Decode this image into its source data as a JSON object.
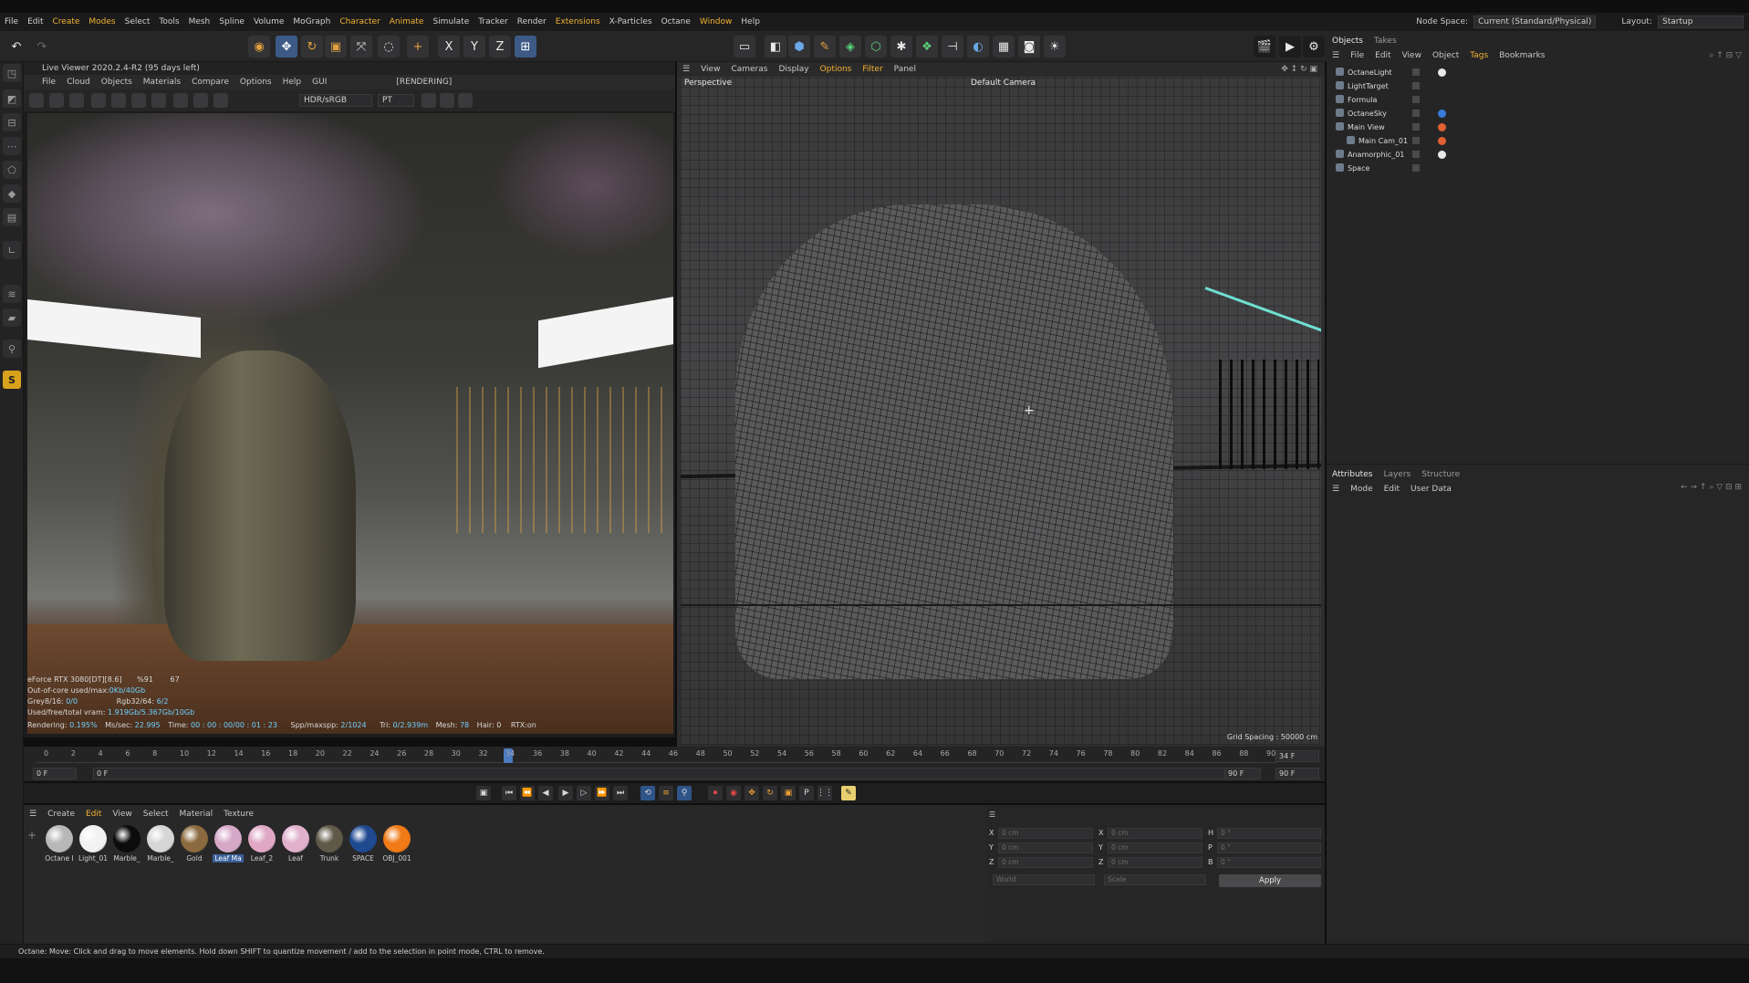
{
  "menubar": {
    "items": [
      {
        "label": "File"
      },
      {
        "label": "Edit"
      },
      {
        "label": "Create"
      },
      {
        "label": "Modes"
      },
      {
        "label": "Select"
      },
      {
        "label": "Tools"
      },
      {
        "label": "Mesh"
      },
      {
        "label": "Spline"
      },
      {
        "label": "Volume"
      },
      {
        "label": "MoGraph"
      },
      {
        "label": "Character"
      },
      {
        "label": "Animate"
      },
      {
        "label": "Simulate"
      },
      {
        "label": "Tracker"
      },
      {
        "label": "Render"
      },
      {
        "label": "Extensions"
      },
      {
        "label": "X-Particles"
      },
      {
        "label": "Octane"
      },
      {
        "label": "Window"
      },
      {
        "label": "Help"
      }
    ],
    "node_space_label": "Node Space:",
    "node_space_value": "Current (Standard/Physical)",
    "layout_label": "Layout:",
    "layout_value": "Startup"
  },
  "live_viewer": {
    "title": "Live Viewer 2020.2.4-R2 (95 days left)",
    "menu": [
      "File",
      "Cloud",
      "Objects",
      "Materials",
      "Compare",
      "Options",
      "Help",
      "GUI"
    ],
    "status": "[RENDERING]",
    "colorspace": "HDR/sRGB",
    "kernel": "PT",
    "stats": {
      "gpu": "eForce RTX 3080[DT][8.6]",
      "gpu_pct": "%91",
      "gpu_temp": "67",
      "ooc_label": "Out-of-core used/max:",
      "ooc_value": "0Kb/40Gb",
      "grey_label": "Grey8/16:",
      "grey_value": "0/0",
      "rgb_label": "Rgb32/64:",
      "rgb_value": "6/2",
      "vram_label": "Used/free/total vram:",
      "vram_value": "1.919Gb/5.367Gb/10Gb",
      "rendering_label": "Rendering:",
      "rendering_value": "0.195%",
      "mssec_label": "Ms/sec:",
      "mssec_value": "22.995",
      "time_label": "Time:",
      "time_value": "00 : 00 : 00/00 : 01 : 23",
      "spp_label": "Spp/maxspp:",
      "spp_value": "2/1024",
      "tri_label": "Tri:",
      "tri_value": "0/2.939m",
      "mesh_label": "Mesh:",
      "mesh_value": "78",
      "hair_label": "Hair:",
      "hair_value": "0",
      "rtx": "RTX:on"
    }
  },
  "viewport": {
    "menu": [
      "View",
      "Cameras",
      "Display",
      "Options",
      "Filter",
      "Panel"
    ],
    "label": "Perspective",
    "camera": "Default Camera",
    "grid_spacing": "Grid Spacing : 50000 cm"
  },
  "timeline": {
    "ticks": [
      "0",
      "2",
      "4",
      "6",
      "8",
      "10",
      "12",
      "14",
      "16",
      "18",
      "20",
      "22",
      "24",
      "26",
      "28",
      "30",
      "32",
      "34",
      "36",
      "38",
      "40",
      "42",
      "44",
      "46",
      "48",
      "50",
      "52",
      "54",
      "56",
      "58",
      "60",
      "62",
      "64",
      "66",
      "68",
      "70",
      "72",
      "74",
      "76",
      "78",
      "80",
      "82",
      "84",
      "86",
      "88",
      "90"
    ],
    "current_frame": "34 F",
    "start_a": "0 F",
    "start_b": "0 F",
    "end_a": "90 F",
    "end_b": "90 F",
    "playhead_fraction": 0.3778
  },
  "materials": {
    "menu": [
      "Create",
      "Edit",
      "View",
      "Select",
      "Material",
      "Texture"
    ],
    "items": [
      {
        "name": "Octane I",
        "color": "#b8b8b8"
      },
      {
        "name": "Light_01",
        "color": "#f2f2f2"
      },
      {
        "name": "Marble_",
        "color": "#0c0c0c"
      },
      {
        "name": "Marble_",
        "color": "#d6d6d6"
      },
      {
        "name": "Gold",
        "color": "#8a6a3e"
      },
      {
        "name": "Leaf Ma",
        "color": "#d6a8c8"
      },
      {
        "name": "Leaf_2",
        "color": "#e0a8c4"
      },
      {
        "name": "Leaf",
        "color": "#e0b0cc"
      },
      {
        "name": "Trunk",
        "color": "#5f5a48"
      },
      {
        "name": "SPACE",
        "color": "#1f4a90"
      },
      {
        "name": "OBJ_001",
        "color": "#f07a16"
      }
    ]
  },
  "coordinates": {
    "rows": [
      {
        "a": "X",
        "a_val": "0 cm",
        "b": "X",
        "b_val": "0 cm",
        "c": "H",
        "c_val": "0 °"
      },
      {
        "a": "Y",
        "a_val": "0 cm",
        "b": "Y",
        "b_val": "0 cm",
        "c": "P",
        "c_val": "0 °"
      },
      {
        "a": "Z",
        "a_val": "0 cm",
        "b": "Z",
        "b_val": "0 cm",
        "c": "B",
        "c_val": "0 °"
      }
    ],
    "mode_a": "World",
    "mode_b": "Scale",
    "apply": "Apply"
  },
  "objects_panel": {
    "tabs": [
      "Objects",
      "Takes"
    ],
    "menu": [
      "File",
      "Edit",
      "View",
      "Object",
      "Tags",
      "Bookmarks"
    ],
    "items": [
      {
        "name": "OctaneLight",
        "tag": "#e8e8e8"
      },
      {
        "name": "LightTarget",
        "tag": ""
      },
      {
        "name": "Formula",
        "tag": ""
      },
      {
        "name": "OctaneSky",
        "tag": "#3b7ad8"
      },
      {
        "name": "Main View",
        "tag": "#e06030"
      },
      {
        "name": "Main Cam_01",
        "tag": "#e06030"
      },
      {
        "name": "Anamorphic_01",
        "tag": "#e8e8e8"
      },
      {
        "name": "Space",
        "tag": ""
      }
    ]
  },
  "attributes_panel": {
    "tabs": [
      "Attributes",
      "Layers",
      "Structure"
    ],
    "menu": [
      "Mode",
      "Edit",
      "User Data"
    ]
  },
  "status_bar": {
    "text": "Octane:    Move: Click and drag to move elements. Hold down SHIFT to quantize movement / add to the selection in point mode, CTRL to remove."
  }
}
